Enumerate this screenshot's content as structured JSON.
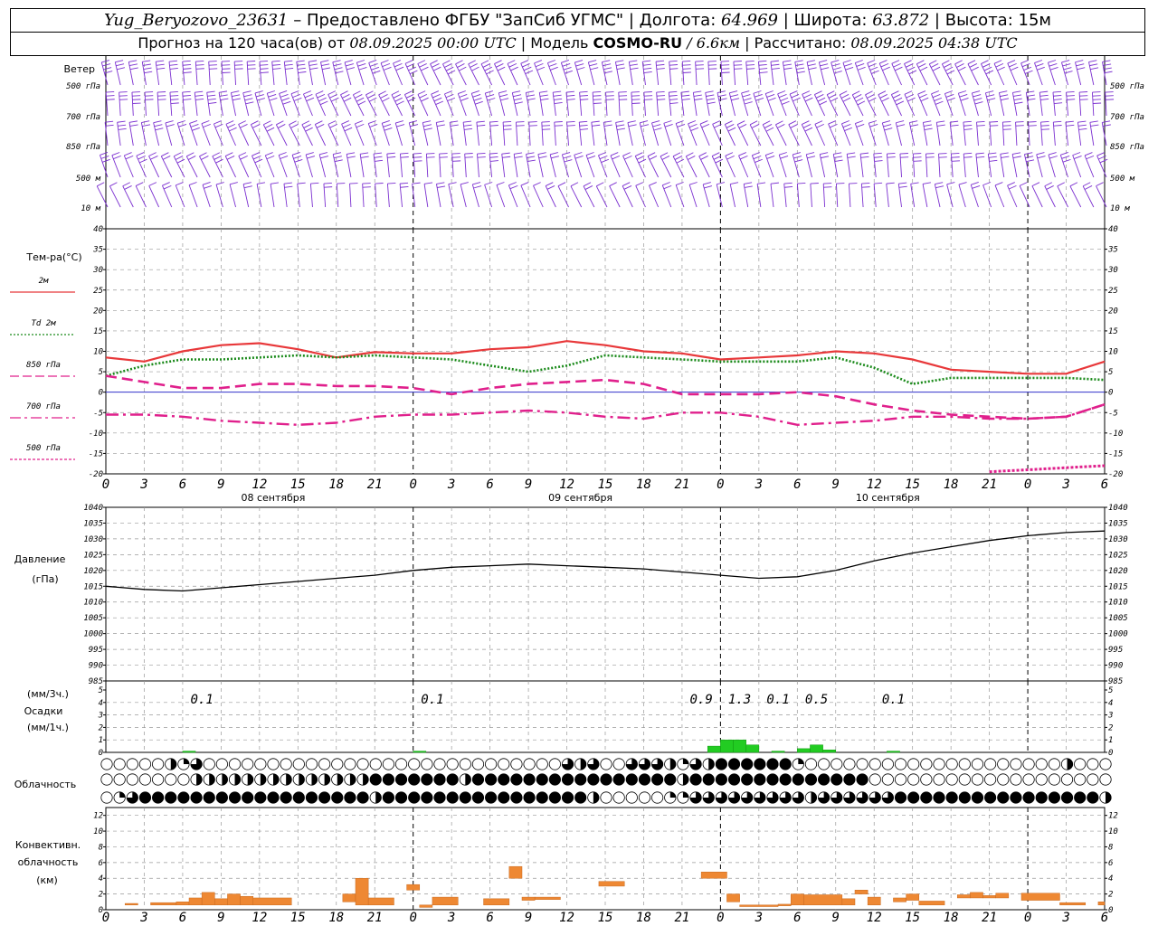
{
  "header": {
    "station": "Yug_Beryozovo_23631",
    "dash": "–",
    "provided": "Предоставлено ФГБУ \"ЗапСиб УГМС\"",
    "lon_label": "Долгота:",
    "lon": "64.969",
    "lat_label": "Широта:",
    "lat": "63.872",
    "alt_label": "Высота:",
    "alt": "15м",
    "forecast_label": "Прогноз на 120 часа(ов) от",
    "forecast_start": "08.09.2025 00:00 UTC",
    "model_label": "Модель",
    "model": "COSMO-RU",
    "model_res": "/ 6.6км",
    "calc_label": "Рассчитано:",
    "calc_time": "08.09.2025 04:38 UTC"
  },
  "labels": {
    "wind": "Ветер",
    "wind_levels": [
      "500 гПа",
      "700 гПа",
      "850 гПа",
      "500 м",
      "10 м"
    ],
    "temp": "Тем-ра(°С)",
    "temp_series": [
      "2м",
      "Td 2м",
      "850 гПа",
      "700 гПа",
      "500 гПа"
    ],
    "pressure": [
      "Давление",
      "(гПа)"
    ],
    "precip": [
      "(мм/3ч.)",
      "Осадки",
      "(мм/1ч.)"
    ],
    "clouds": "Облачность",
    "convective": [
      "Конвективн.",
      "облачность",
      "(км)"
    ]
  },
  "x_ticks": [
    "0",
    "3",
    "6",
    "9",
    "12",
    "15",
    "18",
    "21",
    "0",
    "3",
    "6",
    "9",
    "12",
    "15",
    "18",
    "21",
    "0",
    "3",
    "6",
    "9",
    "12",
    "15",
    "18",
    "21",
    "0",
    "3",
    "6"
  ],
  "day_labels": [
    "08 сентября",
    "09 сентября",
    "10 сентября"
  ],
  "colors": {
    "t2m": "#e8383a",
    "td2m": "#1a8a1a",
    "t850": "#e0208c",
    "t700": "#e0208c",
    "t500": "#e0208c",
    "wind": "#7b2fd0",
    "precip": "#22cc22",
    "conv": "#ee8833",
    "zero_line": "#3333cc",
    "grid": "#999999"
  },
  "chart_data": [
    {
      "type": "line",
      "title": "Тем-ра(°С)",
      "x_hours": [
        0,
        3,
        6,
        9,
        12,
        15,
        18,
        21,
        24,
        27,
        30,
        33,
        36,
        39,
        42,
        45,
        48,
        51,
        54,
        57,
        60,
        63,
        66,
        69,
        72,
        75,
        78
      ],
      "ylim": [
        -20,
        40
      ],
      "y_ticks": [
        40,
        35,
        30,
        25,
        20,
        15,
        10,
        5,
        0,
        -5,
        -10,
        -15,
        -20
      ],
      "series": [
        {
          "name": "2м",
          "style": "solid",
          "values": [
            8.5,
            7.5,
            10,
            11.5,
            12,
            10.5,
            8.5,
            9.8,
            9.5,
            9.5,
            10.5,
            11,
            12.5,
            11.5,
            10,
            9.5,
            8,
            8.5,
            9,
            10,
            9.5,
            8,
            5.5,
            5,
            4.5,
            4.5,
            7.5
          ]
        },
        {
          "name": "Td 2м",
          "style": "dotted",
          "values": [
            4,
            6.5,
            8,
            8,
            8.5,
            9,
            8.5,
            9,
            8.5,
            8,
            6.5,
            5,
            6.5,
            9,
            8.5,
            8,
            7.5,
            7.5,
            7.5,
            8.5,
            6,
            2,
            3.5,
            3.5,
            3.5,
            3.5,
            3
          ]
        },
        {
          "name": "850 гПа",
          "style": "dashed",
          "values": [
            4,
            2.5,
            1,
            1,
            2,
            2,
            1.5,
            1.5,
            1,
            -0.5,
            1,
            2,
            2.5,
            3,
            2,
            -0.5,
            -0.5,
            -0.5,
            0,
            -1,
            -3,
            -4.5,
            -5.5,
            -6,
            -6.5,
            -6,
            -3
          ]
        },
        {
          "name": "700 гПа",
          "style": "dashdot",
          "values": [
            -5.5,
            -5.5,
            -6,
            -7,
            -7.5,
            -8,
            -7.5,
            -6,
            -5.5,
            -5.5,
            -5,
            -4.5,
            -5,
            -6,
            -6.5,
            -5,
            -5,
            -6,
            -8,
            -7.5,
            -7,
            -6,
            -6,
            -6.5,
            -6.5,
            -6,
            -3
          ]
        },
        {
          "name": "500 гПа",
          "style": "dotted",
          "values": [
            null,
            null,
            null,
            null,
            null,
            null,
            null,
            null,
            null,
            null,
            null,
            null,
            null,
            null,
            null,
            null,
            null,
            null,
            null,
            null,
            null,
            null,
            null,
            -19.5,
            -19,
            -18.5,
            -18
          ]
        }
      ]
    },
    {
      "type": "line",
      "title": "Давление (гПа)",
      "x_hours": [
        0,
        3,
        6,
        9,
        12,
        15,
        18,
        21,
        24,
        27,
        30,
        33,
        36,
        39,
        42,
        45,
        48,
        51,
        54,
        57,
        60,
        63,
        66,
        69,
        72,
        75,
        78
      ],
      "ylim": [
        985,
        1040
      ],
      "y_ticks": [
        1040,
        1035,
        1030,
        1025,
        1020,
        1015,
        1010,
        1005,
        1000,
        995,
        990,
        985
      ],
      "series": [
        {
          "name": "Давление",
          "values": [
            1015,
            1014,
            1013.5,
            1014.5,
            1015.5,
            1016.5,
            1017.5,
            1018.5,
            1020,
            1021,
            1021.5,
            1022,
            1021.5,
            1021,
            1020.5,
            1019.5,
            1018.5,
            1017.5,
            1018,
            1020,
            1023,
            1025.5,
            1027.5,
            1029.5,
            1031,
            1032,
            1032.5
          ]
        }
      ]
    },
    {
      "type": "bar",
      "title": "Осадки (мм/3ч.) (мм/1ч.)",
      "ylim": [
        0,
        5
      ],
      "y_ticks": [
        5,
        4,
        3,
        2,
        1,
        0
      ],
      "x_hours": [
        6,
        24,
        47,
        48,
        49,
        50,
        52,
        54,
        55,
        56,
        61
      ],
      "values": [
        0.1,
        0.1,
        0.5,
        1,
        1,
        0.6,
        0.1,
        0.3,
        0.6,
        0.2,
        0.1
      ],
      "three_hour_totals": [
        {
          "hour": 7.5,
          "value": "0.1"
        },
        {
          "hour": 25.5,
          "value": "0.1"
        },
        {
          "hour": 46.5,
          "value": "0.9"
        },
        {
          "hour": 49.5,
          "value": "1.3"
        },
        {
          "hour": 52.5,
          "value": "0.1"
        },
        {
          "hour": 55.5,
          "value": "0.5"
        },
        {
          "hour": 61.5,
          "value": "0.1"
        }
      ]
    },
    {
      "type": "bar",
      "title": "Конвективн. облачность (км)",
      "ylim": [
        0,
        13
      ],
      "y_ticks": [
        12,
        10,
        8,
        6,
        4,
        2,
        0
      ],
      "bars": [
        {
          "x0": 1.5,
          "x1": 2.5,
          "base": 0.6,
          "top": 0.8
        },
        {
          "x0": 3.5,
          "x1": 5.5,
          "base": 0.6,
          "top": 0.9
        },
        {
          "x0": 5.5,
          "x1": 6.5,
          "base": 0.6,
          "top": 1.0
        },
        {
          "x0": 6.5,
          "x1": 7.5,
          "base": 0.6,
          "top": 1.5
        },
        {
          "x0": 7.5,
          "x1": 8.5,
          "base": 0.6,
          "top": 2.2
        },
        {
          "x0": 8.5,
          "x1": 9.5,
          "base": 0.6,
          "top": 1.4
        },
        {
          "x0": 9.5,
          "x1": 10.5,
          "base": 0.6,
          "top": 2.0
        },
        {
          "x0": 10.5,
          "x1": 11.5,
          "base": 0.6,
          "top": 1.7
        },
        {
          "x0": 11.5,
          "x1": 14.5,
          "base": 0.6,
          "top": 1.5
        },
        {
          "x0": 18.5,
          "x1": 19.5,
          "base": 1.0,
          "top": 2.0
        },
        {
          "x0": 19.5,
          "x1": 20.5,
          "base": 0.6,
          "top": 4.0
        },
        {
          "x0": 20.5,
          "x1": 22.5,
          "base": 0.6,
          "top": 1.5
        },
        {
          "x0": 23.5,
          "x1": 24.5,
          "base": 2.5,
          "top": 3.2
        },
        {
          "x0": 24.5,
          "x1": 25.5,
          "base": 0.3,
          "top": 0.6
        },
        {
          "x0": 25.5,
          "x1": 27.5,
          "base": 0.6,
          "top": 1.6
        },
        {
          "x0": 29.5,
          "x1": 31.5,
          "base": 0.6,
          "top": 1.4
        },
        {
          "x0": 31.5,
          "x1": 32.5,
          "base": 4.0,
          "top": 5.5
        },
        {
          "x0": 32.5,
          "x1": 33.5,
          "base": 1.2,
          "top": 1.6
        },
        {
          "x0": 33.5,
          "x1": 35.5,
          "base": 1.3,
          "top": 1.6
        },
        {
          "x0": 38.5,
          "x1": 40.5,
          "base": 3.0,
          "top": 3.6
        },
        {
          "x0": 46.5,
          "x1": 48.5,
          "base": 4.0,
          "top": 4.8
        },
        {
          "x0": 48.5,
          "x1": 49.5,
          "base": 1.0,
          "top": 2.0
        },
        {
          "x0": 49.5,
          "x1": 52.5,
          "base": 0.4,
          "top": 0.6
        },
        {
          "x0": 52.5,
          "x1": 53.5,
          "base": 0.5,
          "top": 0.7
        },
        {
          "x0": 53.5,
          "x1": 54.5,
          "base": 0.6,
          "top": 2.0
        },
        {
          "x0": 54.5,
          "x1": 57.5,
          "base": 0.6,
          "top": 1.9
        },
        {
          "x0": 57.5,
          "x1": 58.5,
          "base": 0.6,
          "top": 1.4
        },
        {
          "x0": 58.5,
          "x1": 59.5,
          "base": 2.0,
          "top": 2.5
        },
        {
          "x0": 59.5,
          "x1": 60.5,
          "base": 0.6,
          "top": 1.6
        },
        {
          "x0": 61.5,
          "x1": 62.5,
          "base": 1.0,
          "top": 1.5
        },
        {
          "x0": 62.5,
          "x1": 63.5,
          "base": 1.2,
          "top": 2.0
        },
        {
          "x0": 63.5,
          "x1": 65.5,
          "base": 0.6,
          "top": 1.1
        },
        {
          "x0": 66.5,
          "x1": 67.5,
          "base": 1.5,
          "top": 1.9
        },
        {
          "x0": 67.5,
          "x1": 68.5,
          "base": 1.5,
          "top": 2.2
        },
        {
          "x0": 68.5,
          "x1": 69.5,
          "base": 1.5,
          "top": 1.8
        },
        {
          "x0": 69.5,
          "x1": 70.5,
          "base": 1.5,
          "top": 2.1
        },
        {
          "x0": 71.5,
          "x1": 74.5,
          "base": 1.2,
          "top": 2.1
        },
        {
          "x0": 74.5,
          "x1": 76.5,
          "base": 0.6,
          "top": 0.9
        },
        {
          "x0": 77.5,
          "x1": 78,
          "base": 0.6,
          "top": 1.0
        }
      ]
    }
  ]
}
